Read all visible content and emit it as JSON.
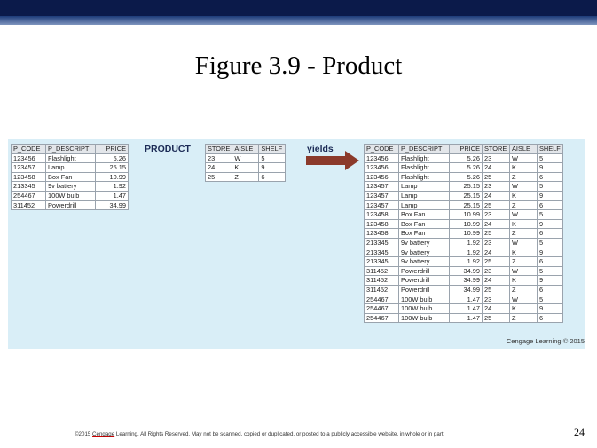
{
  "slide": {
    "title": "Figure 3.9 - Product",
    "product_label": "PRODUCT",
    "yields_label": "yields",
    "credit": "Cengage Learning © 2015",
    "footer_prefix": "©2015 ",
    "footer_brand": "Cengage",
    "footer_rest": " Learning. All Rights Reserved. May not be scanned, copied or duplicated, or posted to a publicly accessible website, in whole or in part.",
    "page_number": "24",
    "colors": {
      "top_bar": "#0b1a4a",
      "panel": "#d9eef7",
      "arrow": "#8b3a2b"
    }
  },
  "product_table": {
    "headers": [
      "P_CODE",
      "P_DESCRIPT",
      "PRICE"
    ],
    "rows": [
      [
        "123456",
        "Flashlight",
        "5.26"
      ],
      [
        "123457",
        "Lamp",
        "25.15"
      ],
      [
        "123458",
        "Box Fan",
        "10.99"
      ],
      [
        "213345",
        "9v battery",
        "1.92"
      ],
      [
        "254467",
        "100W bulb",
        "1.47"
      ],
      [
        "311452",
        "Powerdrill",
        "34.99"
      ]
    ]
  },
  "store_table": {
    "headers": [
      "STORE",
      "AISLE",
      "SHELF"
    ],
    "rows": [
      [
        "23",
        "W",
        "5"
      ],
      [
        "24",
        "K",
        "9"
      ],
      [
        "25",
        "Z",
        "6"
      ]
    ]
  },
  "result_table": {
    "headers": [
      "P_CODE",
      "P_DESCRIPT",
      "PRICE",
      "STORE",
      "AISLE",
      "SHELF"
    ],
    "rows": [
      [
        "123456",
        "Flashlight",
        "5.26",
        "23",
        "W",
        "5"
      ],
      [
        "123456",
        "Flashlight",
        "5.26",
        "24",
        "K",
        "9"
      ],
      [
        "123456",
        "Flashlight",
        "5.26",
        "25",
        "Z",
        "6"
      ],
      [
        "123457",
        "Lamp",
        "25.15",
        "23",
        "W",
        "5"
      ],
      [
        "123457",
        "Lamp",
        "25.15",
        "24",
        "K",
        "9"
      ],
      [
        "123457",
        "Lamp",
        "25.15",
        "25",
        "Z",
        "6"
      ],
      [
        "123458",
        "Box Fan",
        "10.99",
        "23",
        "W",
        "5"
      ],
      [
        "123458",
        "Box Fan",
        "10.99",
        "24",
        "K",
        "9"
      ],
      [
        "123458",
        "Box Fan",
        "10.99",
        "25",
        "Z",
        "6"
      ],
      [
        "213345",
        "9v battery",
        "1.92",
        "23",
        "W",
        "5"
      ],
      [
        "213345",
        "9v battery",
        "1.92",
        "24",
        "K",
        "9"
      ],
      [
        "213345",
        "9v battery",
        "1.92",
        "25",
        "Z",
        "6"
      ],
      [
        "311452",
        "Powerdrill",
        "34.99",
        "23",
        "W",
        "5"
      ],
      [
        "311452",
        "Powerdrill",
        "34.99",
        "24",
        "K",
        "9"
      ],
      [
        "311452",
        "Powerdrill",
        "34.99",
        "25",
        "Z",
        "6"
      ],
      [
        "254467",
        "100W bulb",
        "1.47",
        "23",
        "W",
        "5"
      ],
      [
        "254467",
        "100W bulb",
        "1.47",
        "24",
        "K",
        "9"
      ],
      [
        "254467",
        "100W bulb",
        "1.47",
        "25",
        "Z",
        "6"
      ]
    ]
  }
}
